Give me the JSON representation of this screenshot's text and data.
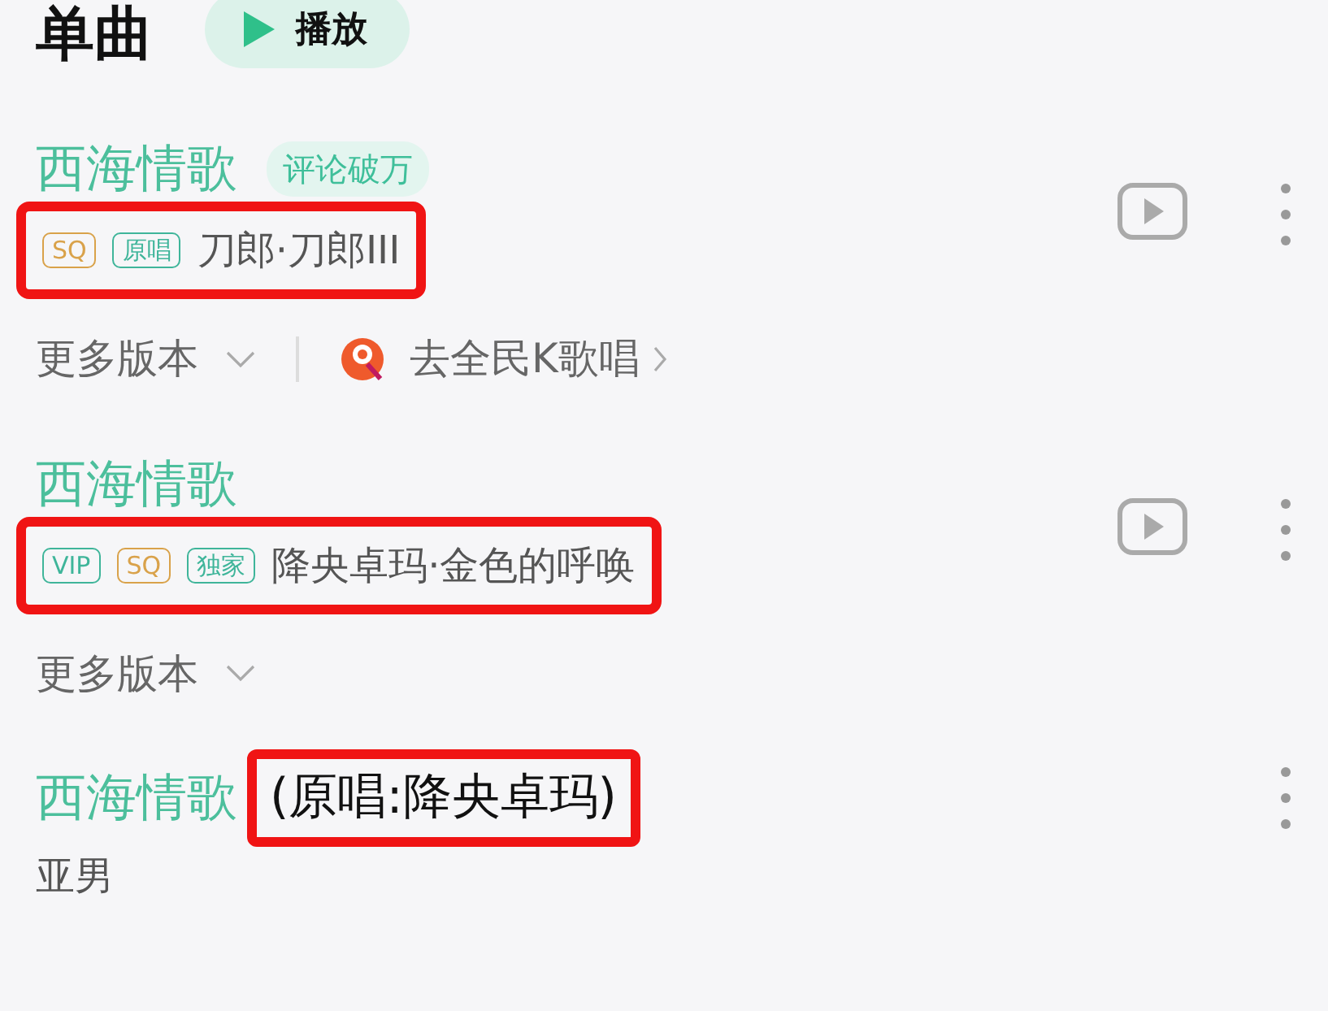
{
  "header": {
    "title": "单曲",
    "play_label": "播放"
  },
  "songs": [
    {
      "title": "西海情歌",
      "badge": "评论破万",
      "tags": [
        {
          "label": "SQ",
          "color": "#d9a24a"
        },
        {
          "label": "原唱",
          "color": "#3fb59a"
        }
      ],
      "artist": "刀郎·刀郎III",
      "highlighted": true,
      "has_video": true,
      "more_versions": "更多版本",
      "karaoke": "去全民K歌唱"
    },
    {
      "title": "西海情歌",
      "tags": [
        {
          "label": "VIP",
          "color": "#3fb59a"
        },
        {
          "label": "SQ",
          "color": "#d9a24a"
        },
        {
          "label": "独家",
          "color": "#3fb59a"
        }
      ],
      "artist": "降央卓玛·金色的呼唤",
      "highlighted": true,
      "has_video": true,
      "more_versions": "更多版本"
    },
    {
      "title": "西海情歌",
      "title_note": "(原唱:降央卓玛)",
      "artist": "亚男",
      "highlighted": true,
      "has_video": false
    }
  ]
}
